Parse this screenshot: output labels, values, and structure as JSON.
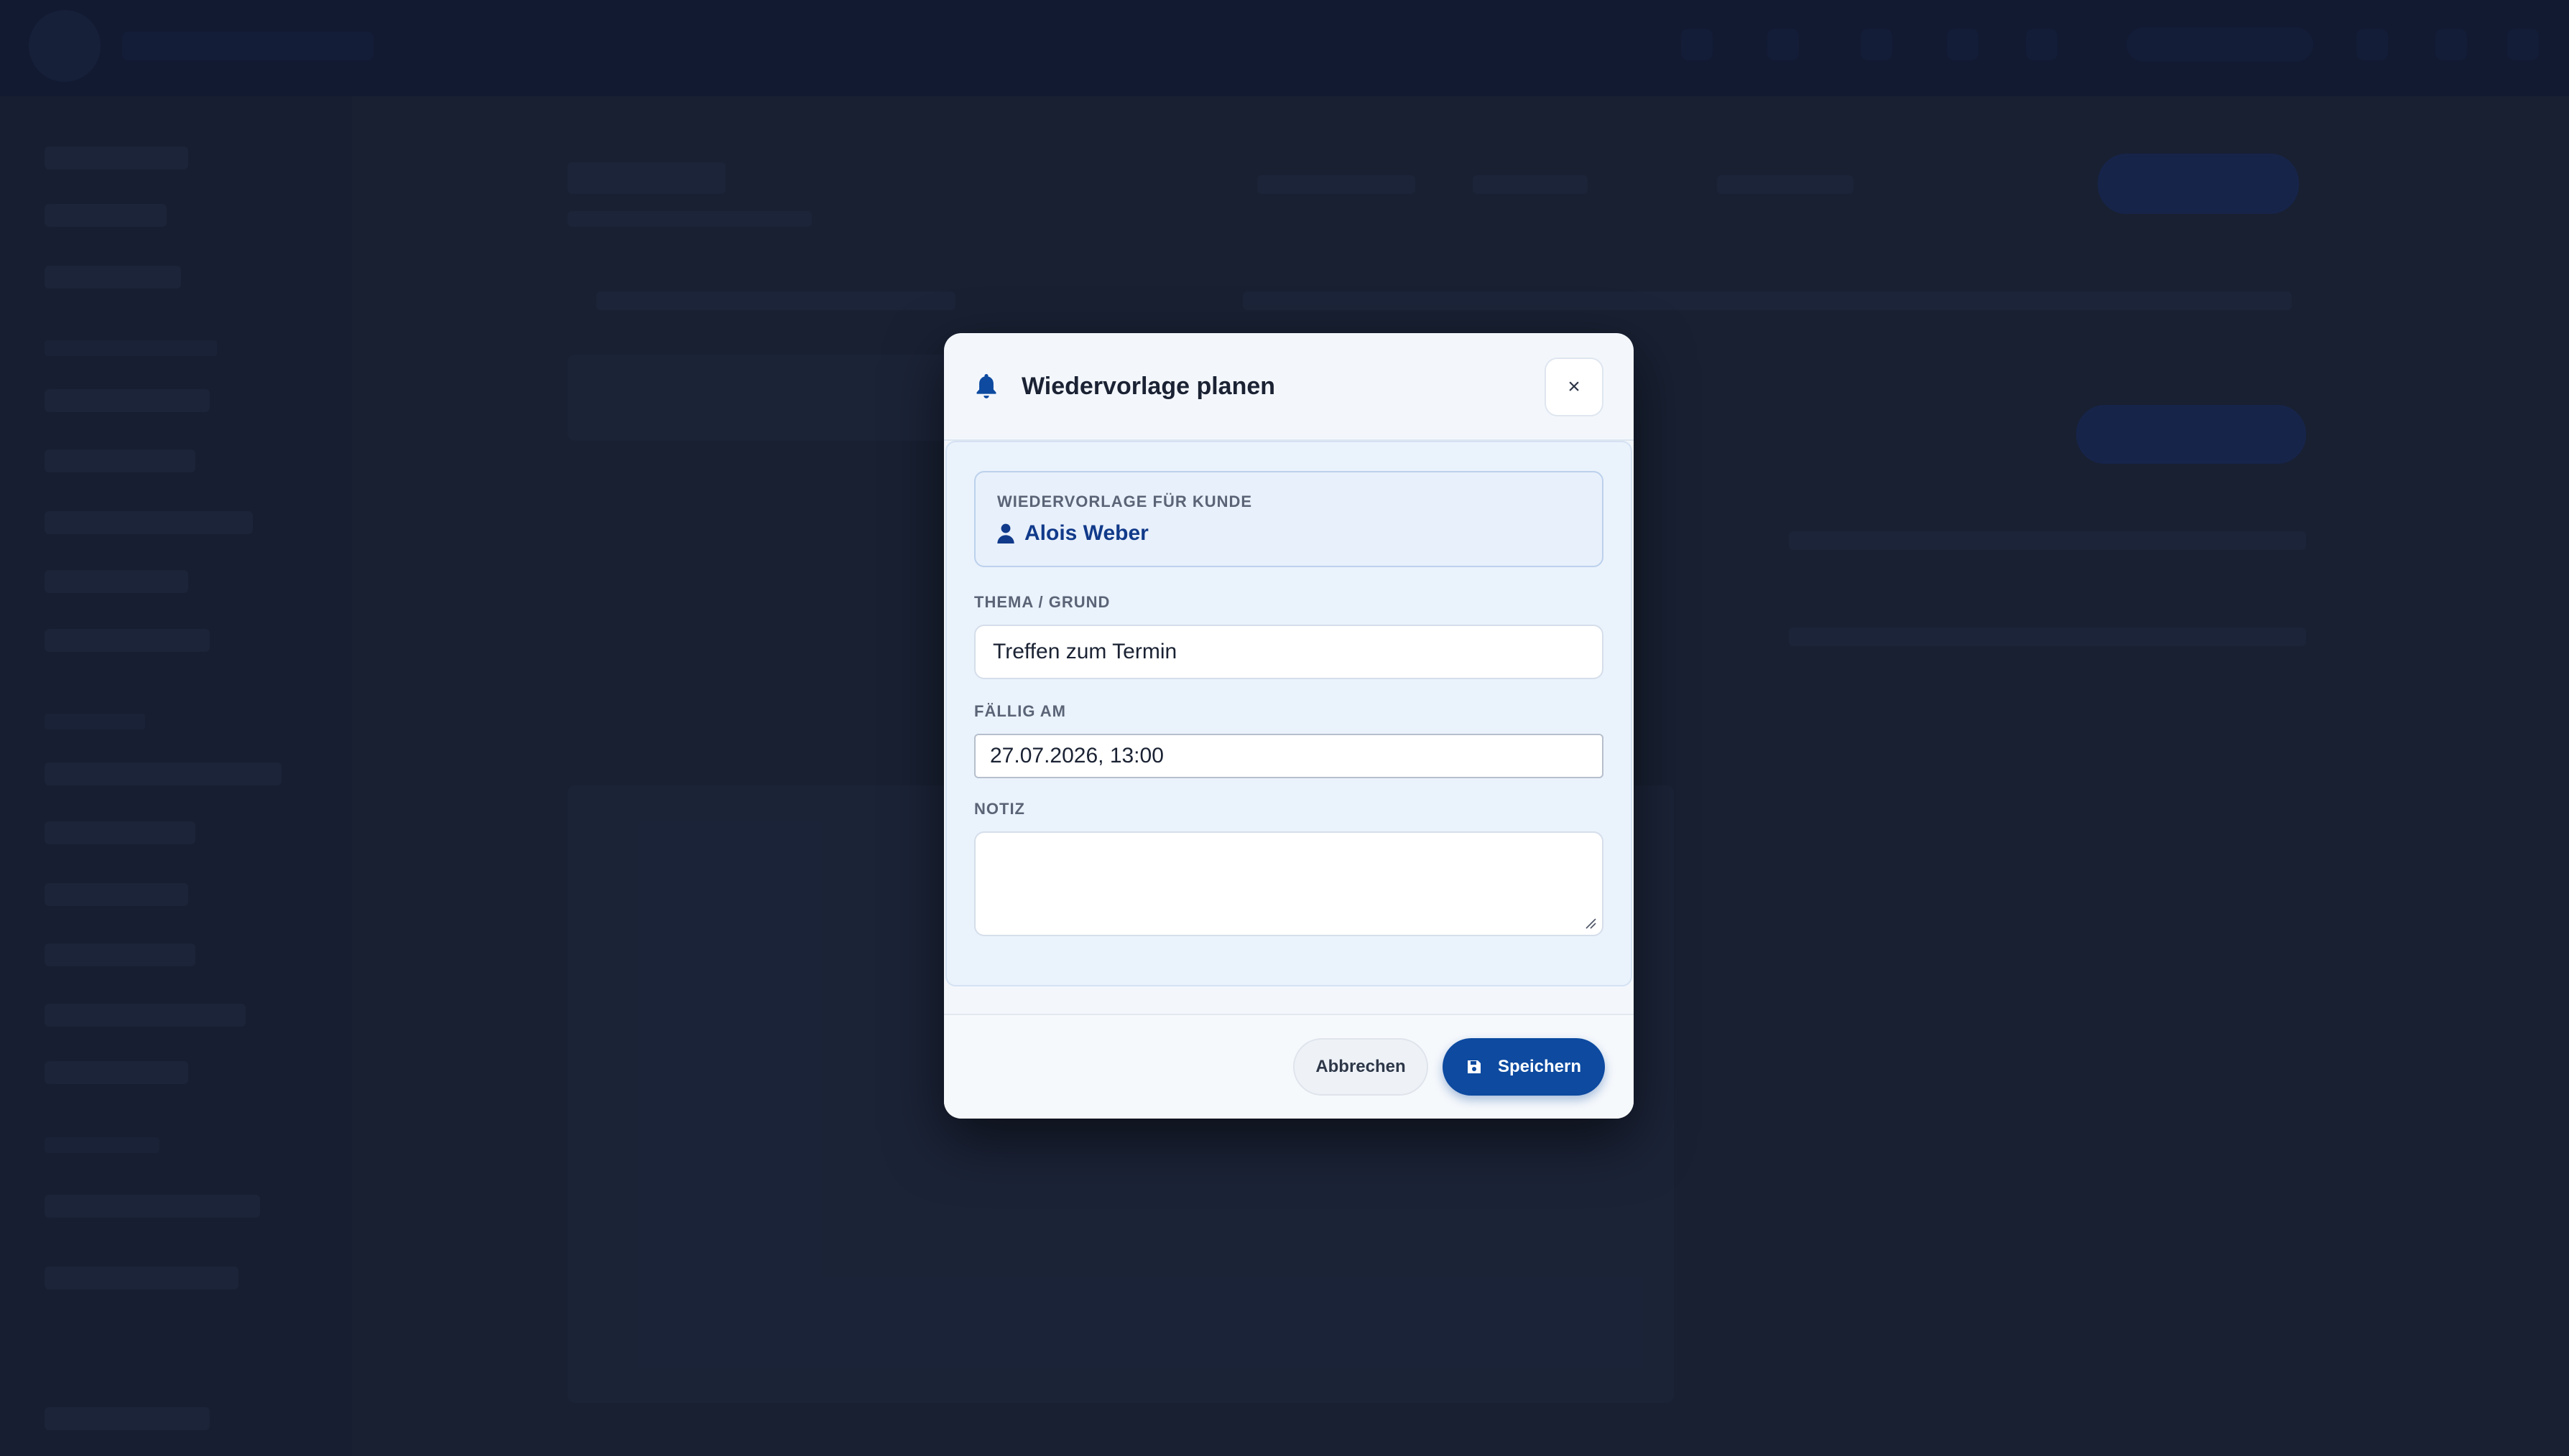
{
  "modal": {
    "title": "Wiedervorlage planen",
    "close_label": "×",
    "customer": {
      "label": "WIEDERVORLAGE FÜR KUNDE",
      "name": "Alois Weber"
    },
    "fields": {
      "topic": {
        "label": "THEMA / GRUND",
        "value": "Treffen zum Termin"
      },
      "due": {
        "label": "FÄLLIG AM",
        "value": "27.07.2026, 13:00"
      },
      "note": {
        "label": "NOTIZ",
        "value": ""
      }
    },
    "footer": {
      "cancel_label": "Abbrechen",
      "save_label": "Speichern"
    }
  },
  "colors": {
    "accent": "#0d4aa0",
    "customer_name": "#113a8a",
    "backdrop": "#1e2538"
  },
  "icons": {
    "title": "bell-icon",
    "customer": "user-icon",
    "save": "save-icon",
    "close": "close-icon"
  }
}
